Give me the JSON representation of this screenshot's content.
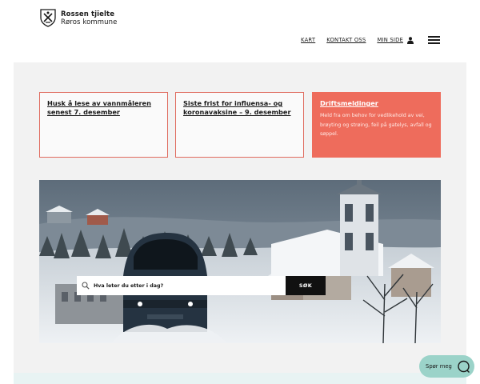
{
  "logo": {
    "line1": "Rossen tjïelte",
    "line2": "Røros kommune",
    "icon": "coat-of-arms-icon"
  },
  "nav": {
    "items": [
      {
        "label": "KART"
      },
      {
        "label": "KONTAKT OSS"
      },
      {
        "label": "MIN SIDE"
      }
    ],
    "user_icon": "user-icon",
    "menu_icon": "hamburger-menu-icon"
  },
  "cards": [
    {
      "title": "Husk å lese av vannmåleren senest 7. desember"
    },
    {
      "title": "Siste frist for influensa- og koronavaksine – 9. desember"
    },
    {
      "title": "Driftsmeldinger",
      "description": "Meld fra om behov for vedlikehold av vei, brøyting og strøing, feil på gatelys, avfall og søppel."
    }
  ],
  "search": {
    "placeholder": "Hva leter du etter i dag?",
    "button_label": "SØK",
    "icon": "search-icon"
  },
  "chat": {
    "label": "Spør meg",
    "icon": "chat-bubble-icon"
  },
  "colors": {
    "accent": "#ee6c5c",
    "card_border": "#e06b5e",
    "chat_bg": "#9bd3c9",
    "page_bg": "#f2f2f2"
  }
}
